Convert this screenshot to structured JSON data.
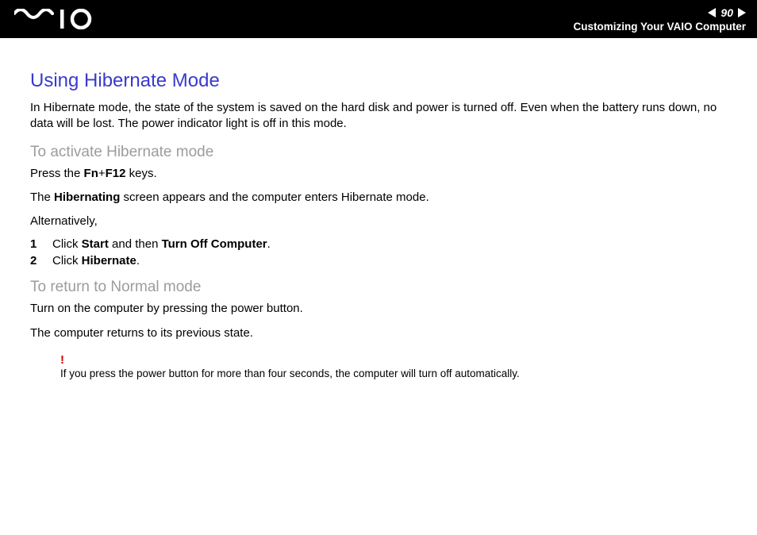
{
  "header": {
    "page_number": "90",
    "section": "Customizing Your VAIO Computer"
  },
  "title": "Using Hibernate Mode",
  "intro": "In Hibernate mode, the state of the system is saved on the hard disk and power is turned off. Even when the battery runs down, no data will be lost. The power indicator light is off in this mode.",
  "activate": {
    "heading": "To activate Hibernate mode",
    "press_pre": "Press the ",
    "press_key1": "Fn",
    "press_plus": "+",
    "press_key2": "F12",
    "press_post": " keys.",
    "line2_pre": "The ",
    "line2_bold": "Hibernating",
    "line2_post": " screen appears and the computer enters Hibernate mode.",
    "alt": "Alternatively,",
    "step1_num": "1",
    "step1_a": "Click ",
    "step1_b": "Start",
    "step1_c": " and then ",
    "step1_d": "Turn Off Computer",
    "step1_e": ".",
    "step2_num": "2",
    "step2_a": "Click ",
    "step2_b": "Hibernate",
    "step2_c": "."
  },
  "return": {
    "heading": "To return to Normal mode",
    "line1": "Turn on the computer by pressing the power button.",
    "line2": "The computer returns to its previous state."
  },
  "note": {
    "bang": "!",
    "text": "If you press the power button for more than four seconds, the computer will turn off automatically."
  }
}
